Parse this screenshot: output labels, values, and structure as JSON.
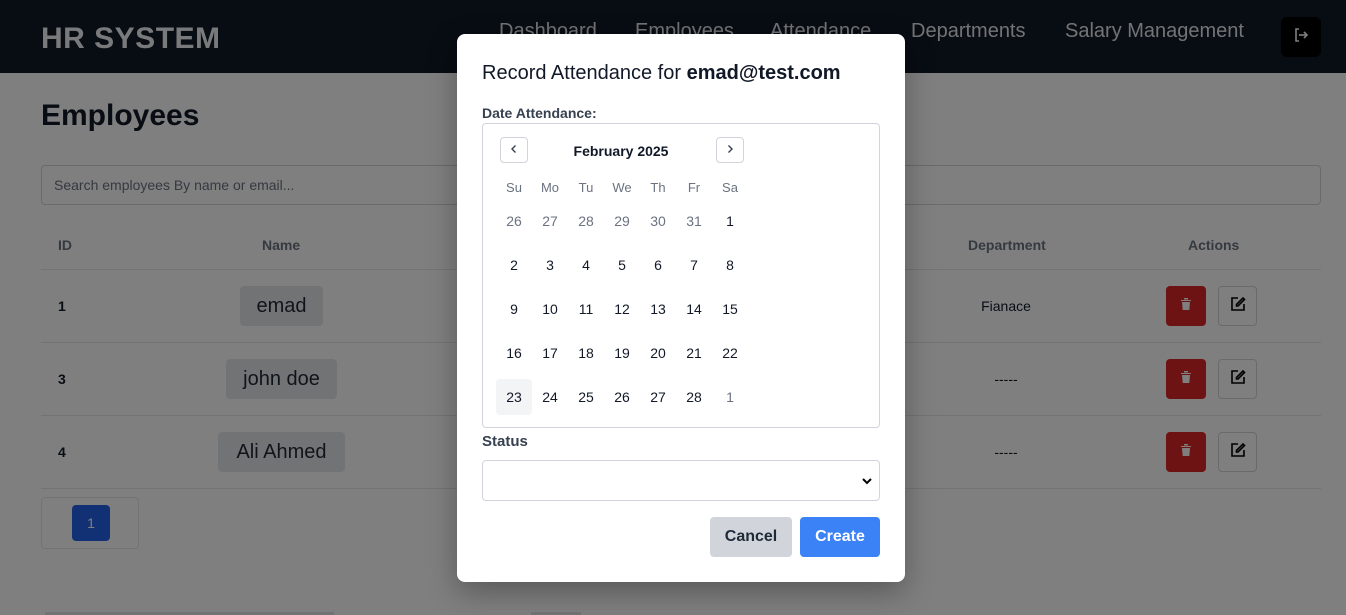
{
  "app": {
    "brand": "HR SYSTEM"
  },
  "nav": {
    "items": [
      "Dashboard",
      "Employees",
      "Attendance",
      "Departments",
      "Salary Management"
    ],
    "logout_icon": "logout-icon"
  },
  "page": {
    "title": "Employees",
    "search_placeholder": "Search employees By name or email..."
  },
  "table": {
    "headers": {
      "id": "ID",
      "name": "Name",
      "department": "Department",
      "actions": "Actions"
    },
    "rows": [
      {
        "id": "1",
        "name": "emad",
        "department": "Fianace"
      },
      {
        "id": "3",
        "name": "john doe",
        "department": "-----"
      },
      {
        "id": "4",
        "name": "Ali Ahmed",
        "department": "-----"
      }
    ]
  },
  "pagination": {
    "current": "1"
  },
  "modal": {
    "title_prefix": "Record Attendance for ",
    "title_email": "emad@test.com",
    "date_label": "Date Attendance:",
    "calendar": {
      "month": "February 2025",
      "weekdays": [
        "Su",
        "Mo",
        "Tu",
        "We",
        "Th",
        "Fr",
        "Sa"
      ],
      "weeks": [
        [
          "26",
          "27",
          "28",
          "29",
          "30",
          "31",
          "1"
        ],
        [
          "2",
          "3",
          "4",
          "5",
          "6",
          "7",
          "8"
        ],
        [
          "9",
          "10",
          "11",
          "12",
          "13",
          "14",
          "15"
        ],
        [
          "16",
          "17",
          "18",
          "19",
          "20",
          "21",
          "22"
        ],
        [
          "23",
          "24",
          "25",
          "26",
          "27",
          "28",
          "1"
        ]
      ],
      "today": "23"
    },
    "status_label": "Status",
    "status_value": "",
    "cancel_label": "Cancel",
    "create_label": "Create"
  },
  "colors": {
    "nav_bg": "#111827",
    "danger": "#dc2626",
    "primary": "#3b82f6",
    "pager": "#2563eb"
  }
}
